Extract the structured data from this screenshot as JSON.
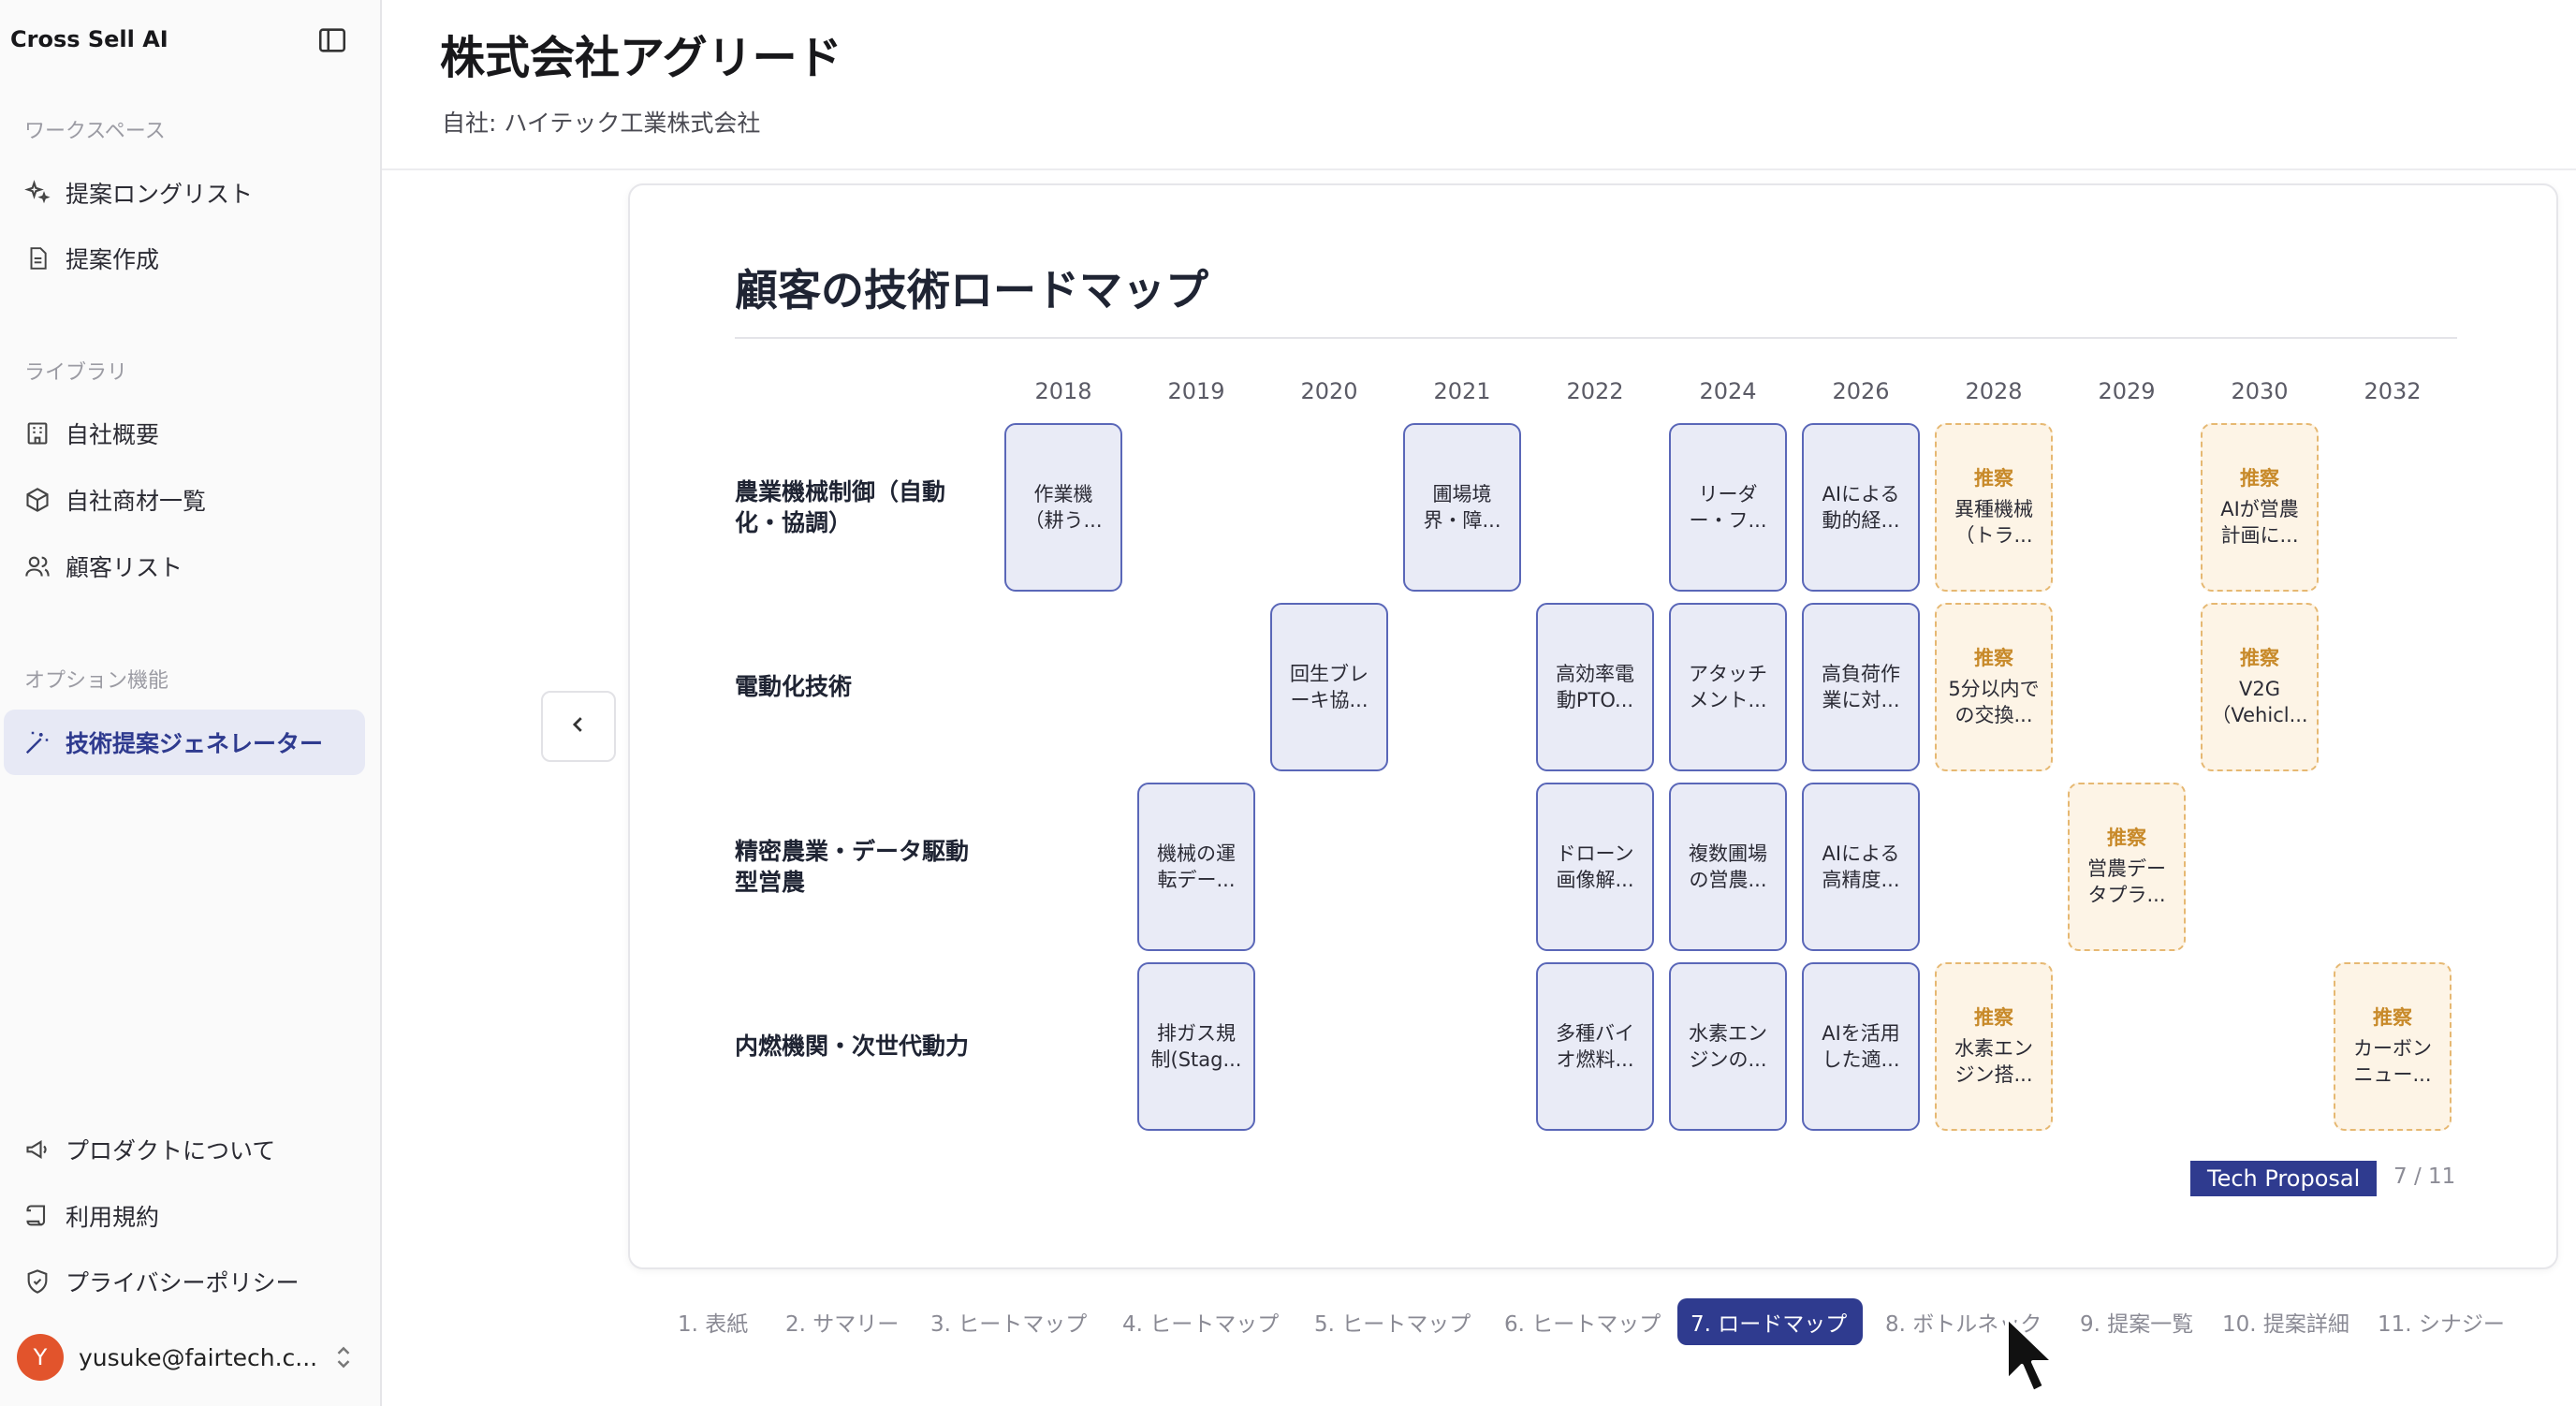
{
  "sidebar": {
    "brand": "Cross Sell AI",
    "sections": {
      "workspace": "ワークスペース",
      "library": "ライブラリ",
      "options": "オプション機能"
    },
    "items": [
      {
        "label": "提案ロングリスト",
        "icon": "sparkles-icon"
      },
      {
        "label": "提案作成",
        "icon": "document-icon"
      },
      {
        "label": "自社概要",
        "icon": "building-icon"
      },
      {
        "label": "自社商材一覧",
        "icon": "box-icon"
      },
      {
        "label": "顧客リスト",
        "icon": "users-icon"
      },
      {
        "label": "技術提案ジェネレーター",
        "icon": "magic-wand-icon"
      }
    ],
    "footer_items": [
      {
        "label": "プロダクトについて",
        "icon": "megaphone-icon"
      },
      {
        "label": "利用規約",
        "icon": "scroll-icon"
      },
      {
        "label": "プライバシーポリシー",
        "icon": "shield-icon"
      }
    ],
    "user": {
      "initial": "Y",
      "email": "yusuke@fairtech.c..."
    }
  },
  "header": {
    "title": "株式会社アグリード",
    "subtitle": "自社: ハイテック工業株式会社"
  },
  "slide": {
    "title": "顧客の技術ロードマップ",
    "years": [
      "2018",
      "2019",
      "2020",
      "2021",
      "2022",
      "2024",
      "2026",
      "2028",
      "2029",
      "2030",
      "2032"
    ],
    "rows": [
      {
        "label": "農業機械制御（自動化・協調）"
      },
      {
        "label": "電動化技術"
      },
      {
        "label": "精密農業・データ駆動型営農"
      },
      {
        "label": "内燃機関・次世代動力"
      }
    ],
    "proposal_tag": "推察",
    "cards": [
      {
        "row": 0,
        "col": 0,
        "type": "existing",
        "text": "作業機（耕う..."
      },
      {
        "row": 0,
        "col": 3,
        "type": "existing",
        "text": "圃場境界・障..."
      },
      {
        "row": 0,
        "col": 5,
        "type": "existing",
        "text": "リーダー・フ..."
      },
      {
        "row": 0,
        "col": 6,
        "type": "existing",
        "text": "AIによる動的経..."
      },
      {
        "row": 0,
        "col": 7,
        "type": "proposal",
        "text": "異種機械（トラ..."
      },
      {
        "row": 0,
        "col": 9,
        "type": "proposal",
        "text": "AIが営農計画に..."
      },
      {
        "row": 1,
        "col": 2,
        "type": "existing",
        "text": "回生ブレーキ協..."
      },
      {
        "row": 1,
        "col": 4,
        "type": "existing",
        "text": "高効率電動PTO..."
      },
      {
        "row": 1,
        "col": 5,
        "type": "existing",
        "text": "アタッチメント..."
      },
      {
        "row": 1,
        "col": 6,
        "type": "existing",
        "text": "高負荷作業に対..."
      },
      {
        "row": 1,
        "col": 7,
        "type": "proposal",
        "text": "5分以内での交換..."
      },
      {
        "row": 1,
        "col": 9,
        "type": "proposal",
        "text": "V2G（Vehicl..."
      },
      {
        "row": 2,
        "col": 1,
        "type": "existing",
        "text": "機械の運転デー..."
      },
      {
        "row": 2,
        "col": 4,
        "type": "existing",
        "text": "ドローン画像解..."
      },
      {
        "row": 2,
        "col": 5,
        "type": "existing",
        "text": "複数圃場の営農..."
      },
      {
        "row": 2,
        "col": 6,
        "type": "existing",
        "text": "AIによる高精度..."
      },
      {
        "row": 2,
        "col": 8,
        "type": "proposal",
        "text": "営農データプラ..."
      },
      {
        "row": 3,
        "col": 1,
        "type": "existing",
        "text": "排ガス規制(Stag..."
      },
      {
        "row": 3,
        "col": 4,
        "type": "existing",
        "text": "多種バイオ燃料..."
      },
      {
        "row": 3,
        "col": 5,
        "type": "existing",
        "text": "水素エンジンの..."
      },
      {
        "row": 3,
        "col": 6,
        "type": "existing",
        "text": "AIを活用した適..."
      },
      {
        "row": 3,
        "col": 7,
        "type": "proposal",
        "text": "水素エンジン搭..."
      },
      {
        "row": 3,
        "col": 10,
        "type": "proposal",
        "text": "カーボンニュー..."
      }
    ],
    "footer_badge": "Tech Proposal",
    "page_indicator": "7 / 11"
  },
  "tabs": [
    {
      "label": "1. 表紙"
    },
    {
      "label": "2. サマリー"
    },
    {
      "label": "3. ヒートマップ"
    },
    {
      "label": "4. ヒートマップ"
    },
    {
      "label": "5. ヒートマップ"
    },
    {
      "label": "6. ヒートマップ"
    },
    {
      "label": "7. ロードマップ"
    },
    {
      "label": "8. ボトルネック"
    },
    {
      "label": "9. 提案一覧"
    },
    {
      "label": "10. 提案詳細"
    },
    {
      "label": "11. シナジー"
    }
  ],
  "active_tab": 6,
  "colors": {
    "accent": "#2f3b8f",
    "existing_border": "#5a67b8",
    "proposal_border": "#e6b872",
    "proposal_tag": "#c88a2a",
    "avatar": "#e2542c"
  }
}
